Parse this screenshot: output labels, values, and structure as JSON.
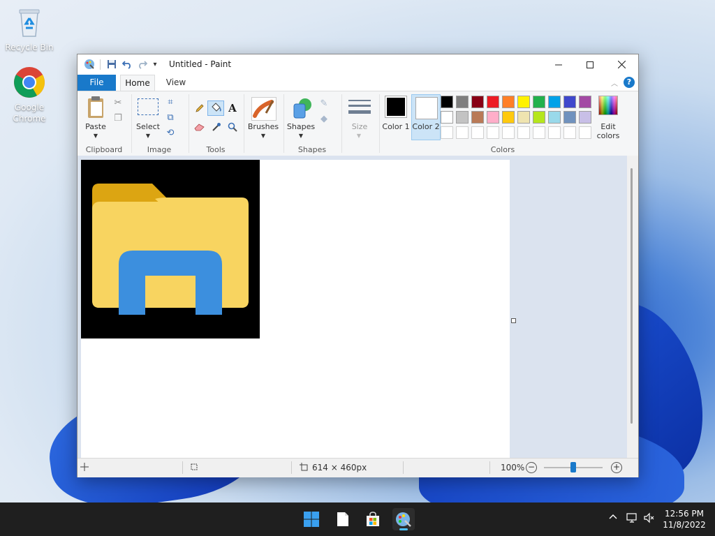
{
  "desktop": {
    "icons": [
      {
        "label": "Recycle Bin",
        "icon": "recycle-bin-icon"
      },
      {
        "label": "Google Chrome",
        "icon": "chrome-icon"
      }
    ]
  },
  "window": {
    "title": "Untitled - Paint",
    "tabs": {
      "file": "File",
      "home": "Home",
      "view": "View"
    },
    "ribbon": {
      "paste": "Paste",
      "select": "Select",
      "brushes": "Brushes",
      "shapes": "Shapes",
      "size": "Size",
      "color1": "Color 1",
      "color2": "Color 2",
      "edit_colors": "Edit colors",
      "groups": {
        "clipboard": "Clipboard",
        "image": "Image",
        "tools": "Tools",
        "shapes": "Shapes",
        "colors": "Colors"
      }
    },
    "palette": {
      "row1": [
        "#000000",
        "#7f7f7f",
        "#880015",
        "#ed1c24",
        "#ff7f27",
        "#fff200",
        "#22b14c",
        "#00a2e8",
        "#3f48cc",
        "#a349a4"
      ],
      "row2": [
        "#ffffff",
        "#c3c3c3",
        "#b97a57",
        "#ffaec9",
        "#ffc90e",
        "#efe4b0",
        "#b5e61d",
        "#99d9ea",
        "#7092be",
        "#c8bfe7"
      ],
      "row3": [
        "#ffffff",
        "#ffffff",
        "#ffffff",
        "#ffffff",
        "#ffffff",
        "#ffffff",
        "#ffffff",
        "#ffffff",
        "#ffffff",
        "#ffffff"
      ]
    },
    "status": {
      "dimensions": "614 × 460px",
      "zoom": "100%"
    }
  },
  "taskbar": {
    "time": "12:56 PM",
    "date": "11/8/2022"
  }
}
